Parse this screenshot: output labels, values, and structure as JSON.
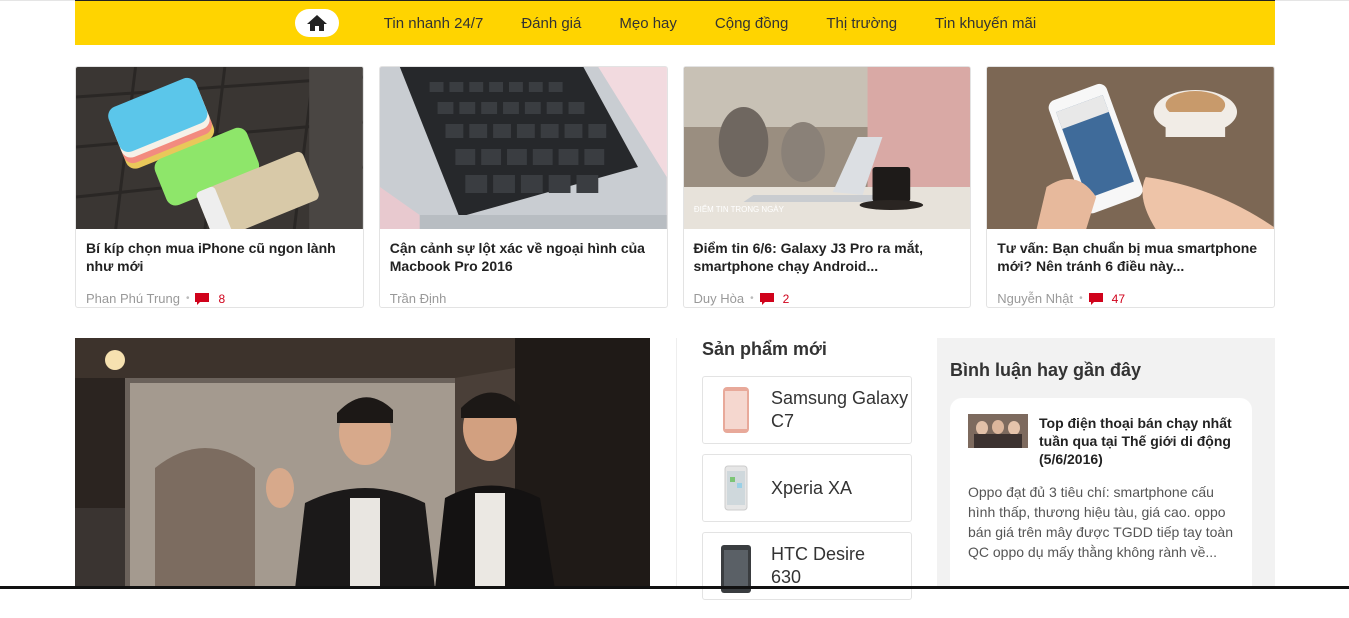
{
  "nav": {
    "items": [
      "Tin nhanh 24/7",
      "Đánh giá",
      "Mẹo hay",
      "Cộng đồng",
      "Thị trường",
      "Tin khuyến mãi"
    ]
  },
  "cards": [
    {
      "title": "Bí kíp chọn mua iPhone cũ ngon lành như mới",
      "author": "Phan Phú Trung",
      "comments": "8"
    },
    {
      "title": "Cận cảnh sự lột xác về ngoại hình của Macbook Pro 2016",
      "author": "Trần Định",
      "comments": ""
    },
    {
      "title": "Điểm tin 6/6: Galaxy J3 Pro ra mắt, smartphone chạy Android...",
      "author": "Duy Hòa",
      "comments": "2",
      "thumb_caption": "ĐIỂM TIN TRONG NGÀY"
    },
    {
      "title": "Tư vấn: Bạn chuẩn bị mua smartphone mới? Nên tránh 6 điều này...",
      "author": "Nguyễn Nhật",
      "comments": "47"
    }
  ],
  "products": {
    "title": "Sản phẩm mới",
    "items": [
      "Samsung Galaxy C7",
      "Xperia XA",
      "HTC Desire 630"
    ]
  },
  "recent_comments": {
    "title": "Bình luận hay gần đây",
    "item": {
      "link": "Top điện thoại bán chạy nhất tuần qua tại Thế giới di động (5/6/2016)",
      "body": "Oppo đạt đủ 3 tiêu chí: smartphone cấu hình thấp, thương hiệu tàu, giá cao. oppo bán giá trên mây được TGDD tiếp tay toàn QC oppo dụ mấy thằng không rành về..."
    }
  },
  "colors": {
    "nav_bg": "#ffd400",
    "comment_icon": "#d0021b"
  },
  "icons": {
    "home": "home-icon",
    "comment": "comment-icon"
  }
}
